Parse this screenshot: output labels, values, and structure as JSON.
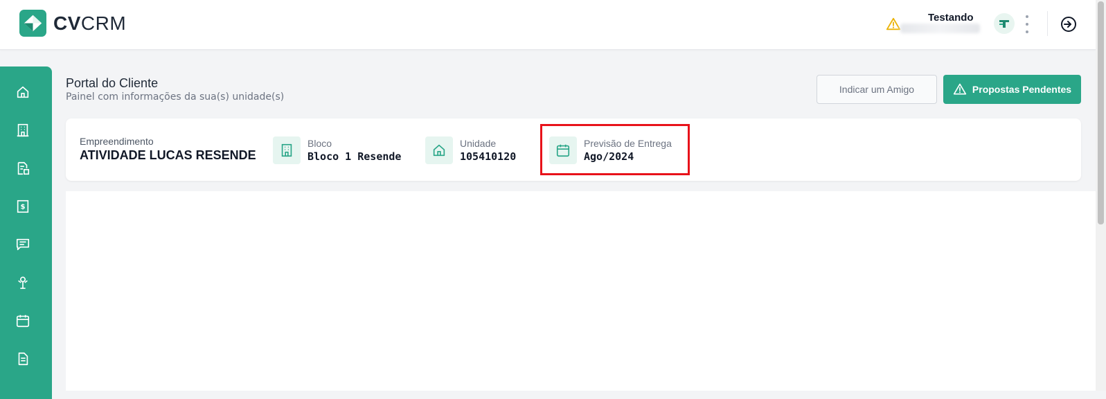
{
  "app": {
    "logo_bold": "CV",
    "logo_light": "CRM"
  },
  "header": {
    "user_name": "Testando",
    "icons": [
      "warning-icon",
      "avatar-icon",
      "kebab-menu-icon",
      "logout-icon"
    ]
  },
  "sidebar": {
    "items": [
      {
        "name": "home",
        "icon": "home-icon"
      },
      {
        "name": "building",
        "icon": "building-icon"
      },
      {
        "name": "documents",
        "icon": "document-icon"
      },
      {
        "name": "financial",
        "icon": "financial-icon"
      },
      {
        "name": "messages",
        "icon": "message-icon"
      },
      {
        "name": "assistance",
        "icon": "assistance-icon"
      },
      {
        "name": "calendar",
        "icon": "calendar-icon"
      },
      {
        "name": "files",
        "icon": "file-icon"
      }
    ]
  },
  "page": {
    "title": "Portal do Cliente",
    "subtitle": "Painel com informações da sua(s) unidade(s)"
  },
  "actions": {
    "indicate_friend": "Indicar um Amigo",
    "pending_proposals": "Propostas Pendentes"
  },
  "info": {
    "empreendimento_label": "Empreendimento",
    "empreendimento_value": "ATIVIDADE LUCAS RESENDE",
    "bloco_label": "Bloco",
    "bloco_value": "Bloco 1 Resende",
    "unidade_label": "Unidade",
    "unidade_value": "105410120",
    "previsao_label": "Previsão de Entrega",
    "previsao_value": "Ago/2024"
  },
  "colors": {
    "brand": "#2aa688",
    "highlight": "#e8121a",
    "warning": "#eab308"
  }
}
